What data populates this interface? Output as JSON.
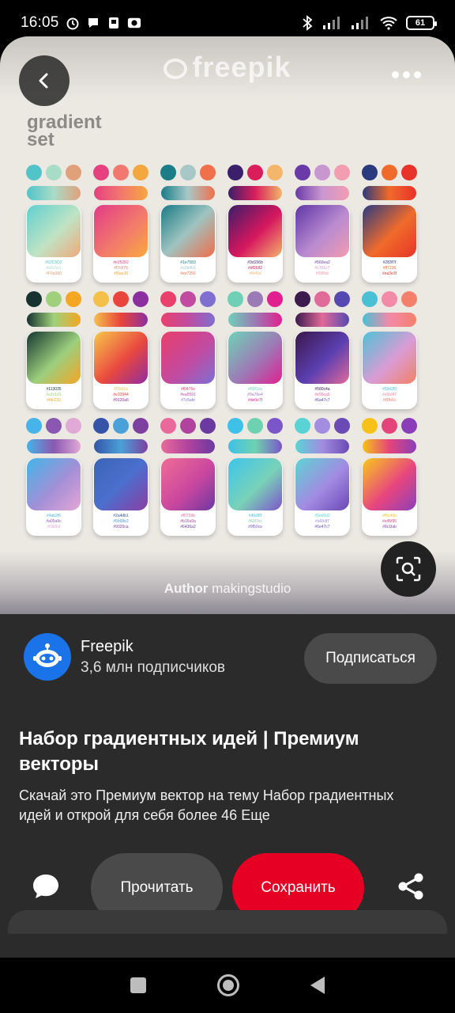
{
  "status": {
    "time": "16:05",
    "battery": "61"
  },
  "pin": {
    "brand": "freepik",
    "set_title_line1": "gradient",
    "set_title_line2": "set",
    "author_label": "Author",
    "author_name": "makingstudio",
    "cards": [
      {
        "dots": [
          "#52c3c9",
          "#a9dcc7",
          "#e0a07a"
        ],
        "grad": "linear-gradient(135deg,#5fd0cf,#bfe3c4 55%,#f0a87a)",
        "codes": [
          "#52C5D2",
          "#a5c5e1",
          "#F0a380"
        ]
      },
      {
        "dots": [
          "#e6407f",
          "#f2776e",
          "#f5a73f"
        ],
        "grad": "linear-gradient(135deg,#e23a86,#f2796c 55%,#f8a93e)",
        "codes": [
          "#e25282",
          "#f7c679",
          "#f9ae38"
        ]
      },
      {
        "dots": [
          "#1a7d88",
          "#a8c8c8",
          "#f0704b"
        ],
        "grad": "linear-gradient(135deg,#1b7a86,#9ec4c0 50%,#f16c48)",
        "codes": [
          "#1e7583",
          "#a0b4b6",
          "#ee7256"
        ]
      },
      {
        "dots": [
          "#3b1f6a",
          "#d91e5b",
          "#f3b66b"
        ],
        "grad": "linear-gradient(135deg,#3b1d69,#d6175e 55%,#f4b26c)",
        "codes": [
          "#3d156b",
          "#df2682",
          "#fe45d"
        ]
      },
      {
        "dots": [
          "#6a3aa8",
          "#c997cf",
          "#f29db0"
        ],
        "grad": "linear-gradient(135deg,#5f35a6,#b98bd0 55%,#f59bb0)",
        "codes": [
          "#560ea2",
          "#c701c7",
          "#f98fab"
        ]
      },
      {
        "dots": [
          "#2b3a7d",
          "#f06a2a",
          "#e8322a"
        ],
        "grad": "linear-gradient(135deg,#2a3b7f,#f16b2b 55%,#e63428)",
        "codes": [
          "#283f7f",
          "#ff7236",
          "#ea3e3f"
        ]
      },
      {
        "dots": [
          "#17332f",
          "#9fd07c",
          "#f5a623"
        ],
        "grad": "linear-gradient(135deg,#153530,#9ccf7d 55%,#f4a524)",
        "codes": [
          "#113035",
          "#a1c1d1",
          "#f4c233"
        ]
      },
      {
        "dots": [
          "#f5c04a",
          "#e8453c",
          "#8b2fa0"
        ],
        "grad": "linear-gradient(135deg,#f7c84a,#e94840 55%,#8d2d9f)",
        "codes": [
          "#f1b91a",
          "#e33944",
          "#9120a6"
        ]
      },
      {
        "dots": [
          "#e9416c",
          "#c04ba0",
          "#7f6fd0"
        ],
        "grad": "linear-gradient(135deg,#ea3f6b,#c24aa0 55%,#7c70d2)",
        "codes": [
          "#f0476e",
          "#ea5591",
          "#7c5afe"
        ]
      },
      {
        "dots": [
          "#6fd0b6",
          "#9a7bb5",
          "#e21f8e"
        ],
        "grad": "linear-gradient(135deg,#6fd3b7,#9c7ab6 55%,#e0208f)",
        "codes": [
          "#60f1ca",
          "#9a76e4",
          "#de0e7f"
        ]
      },
      {
        "dots": [
          "#3b1a4d",
          "#e06a9a",
          "#5548b0"
        ],
        "grad": "linear-gradient(135deg,#3a184c,#5b3fb0 55%,#e46a9a)",
        "codes": [
          "#580c4a",
          "#e56ca9",
          "#6a47c7"
        ]
      },
      {
        "dots": [
          "#4bc0d4",
          "#f28aa8",
          "#f47f6a"
        ],
        "grad": "linear-gradient(135deg,#4fc1d6,#d99cd4 55%,#f28166)",
        "codes": [
          "#59d2f0",
          "#e6b9f7",
          "#f1fb6c"
        ]
      },
      {
        "dots": [
          "#46b4e8",
          "#8a58b0",
          "#e0a9d6"
        ],
        "grad": "linear-gradient(135deg,#42b5ea,#a48fd6 55%,#e6a6d6)",
        "codes": [
          "#4ab2f6",
          "#a05a9c",
          "#f3b9af"
        ]
      },
      {
        "dots": [
          "#3554a8",
          "#4aa0d8",
          "#7d3fa0"
        ],
        "grad": "linear-gradient(135deg,#3b65b6,#4b6fcd 50%,#8b3ea2)",
        "codes": [
          "#2a4db1",
          "#5b98e2",
          "#9320ca"
        ]
      },
      {
        "dots": [
          "#e96a9a",
          "#b0439e",
          "#6b3aa0"
        ],
        "grad": "linear-gradient(135deg,#f06b95,#c9479f 55%,#6d38a1)",
        "codes": [
          "#f0769b",
          "#b16a9a",
          "#6436a2"
        ]
      },
      {
        "dots": [
          "#3ec0e8",
          "#6ed2b0",
          "#7b56c8"
        ],
        "grad": "linear-gradient(135deg,#3ec4ec,#79d2b8 55%,#7c55c9)",
        "codes": [
          "#4fc8f0",
          "#63f7cc",
          "#9f50ce"
        ]
      },
      {
        "dots": [
          "#5ad3d6",
          "#a38de0",
          "#6a4ab4"
        ],
        "grad": "linear-gradient(135deg,#5dd4d4,#a28ae2 55%,#6b47b5)",
        "codes": [
          "#5ee0d2",
          "#a68df7",
          "#6e47c7"
        ]
      },
      {
        "dots": [
          "#f6c21a",
          "#e5447a",
          "#8a3fb8"
        ],
        "grad": "linear-gradient(135deg,#f8c91d,#e8467d 55%,#8c3fb9)",
        "codes": [
          "#f9c40b",
          "#e45f95",
          "#8c1fab"
        ]
      }
    ]
  },
  "creator": {
    "name": "Freepik",
    "subscribers": "3,6 млн подписчиков",
    "follow_label": "Подписаться"
  },
  "pin_title": "Набор градиентных идей | Премиум векторы",
  "description": "Скачай это Премиум вектор на тему Набор градиентных идей и открой для себя более 46 Еще",
  "actions": {
    "read_label": "Прочитать",
    "save_label": "Сохранить"
  }
}
